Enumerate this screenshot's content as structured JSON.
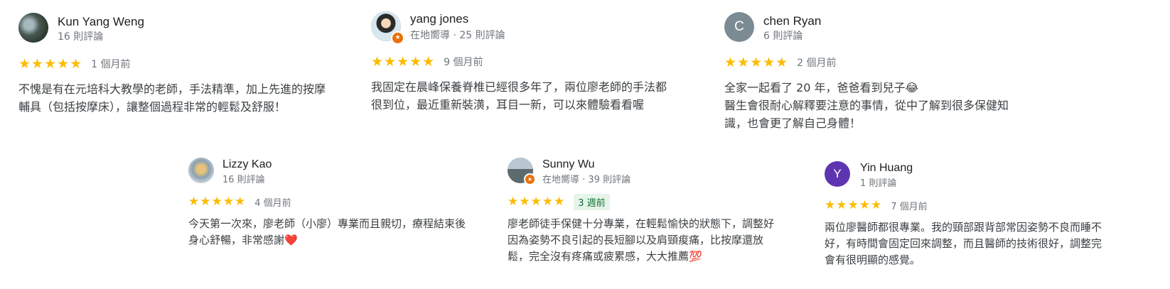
{
  "reviews": [
    {
      "name": "Kun Yang Weng",
      "meta": "16 則評論",
      "stars": "★★★★★",
      "when": "1 個月前",
      "text": "不愧是有在元培科大教學的老師，手法精準，加上先進的按摩輔具（包括按摩床），讓整個過程非常的輕鬆及舒服！",
      "avatar": "photo"
    },
    {
      "name": "yang jones",
      "meta": "在地嚮導 · 25 則評論",
      "stars": "★★★★★",
      "when": "9 個月前",
      "text": "我固定在晨峰保養脊椎已經很多年了，兩位廖老師的手法都很到位，最近重新裝潢，耳目一新，可以來體驗看看喔",
      "avatar": "photo",
      "badge": "★"
    },
    {
      "name": "chen Ryan",
      "meta": "6 則評論",
      "stars": "★★★★★",
      "when": "2 個月前",
      "text_line1": "全家一起看了 20 年，爸爸看到兒子😂",
      "text_line2": "醫生會很耐心解釋要注意的事情，從中了解到很多保健知識，也會更了解自己身體！",
      "avatar_letter": "C",
      "avatar_color": "#7c8a93"
    },
    {
      "name": "Lizzy Kao",
      "meta": "16 則評論",
      "stars": "★★★★★",
      "when": "4 個月前",
      "text": "今天第一次來，廖老師（小廖）專業而且親切，療程結束後身心舒暢，非常感謝❤️",
      "avatar": "photo"
    },
    {
      "name": "Sunny Wu",
      "meta": "在地嚮導 · 39 則評論",
      "stars": "★★★★★",
      "when": "3 週前",
      "text": "廖老師徒手保健十分專業，在輕鬆愉快的狀態下，調整好因為姿勢不良引起的長短腳以及肩頸痠痛，比按摩還放鬆，完全沒有疼痛或疲累感，大大推薦💯",
      "avatar": "photo",
      "badge": "★"
    },
    {
      "name": "Yin Huang",
      "meta": "1 則評論",
      "stars": "★★★★★",
      "when": "7 個月前",
      "text": "兩位廖醫師都很專業。我的頸部跟背部常因姿勢不良而睡不好，有時間會固定回來調整，而且醫師的技術很好，調整完會有很明顯的感覺。",
      "avatar_letter": "Y",
      "avatar_color": "#5e35b1"
    }
  ]
}
